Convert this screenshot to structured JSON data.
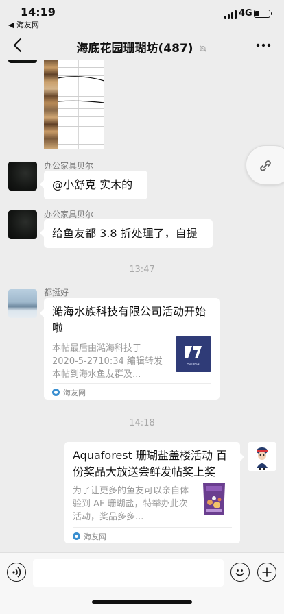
{
  "status": {
    "time": "14:19",
    "back_app": "◀ 海友网",
    "network": "4G",
    "battery_level": 0.3
  },
  "nav": {
    "title": "海底花园珊瑚坊(487)"
  },
  "messages": {
    "m1": {
      "nick": "办公家具贝尔",
      "text": "@小舒克 实木的"
    },
    "m2": {
      "nick": "办公家具贝尔",
      "text": "给鱼友都 3.8 折处理了，自提"
    },
    "t1": "13:47",
    "m3": {
      "nick": "都挺好",
      "card_title": "澔海水族科技有限公司活动开始啦",
      "card_desc": "本帖最后由澔海科技于 2020-5-2710:34 编辑转发本帖到海水鱼友群及...",
      "thumb_text": "HAOHAI",
      "source": "海友网"
    },
    "t2": "14:18",
    "m4": {
      "card_title": "Aquaforest 珊瑚盐盖楼活动 百份奖品大放送尝鲜发帖奖上奖",
      "card_desc": "为了让更多的鱼友可以亲自体验到 AF 珊瑚盐，特举办此次活动，奖品多多...",
      "source": "海友网"
    }
  },
  "colors": {
    "bg": "#ededed",
    "bubble": "#ffffff",
    "meta": "#a8a8a8",
    "source_icon": "#3a8fd0",
    "thumb_bg": "#2f3b77"
  },
  "icons": [
    "back-chevron-icon",
    "mute-bell-icon",
    "more-dots-icon",
    "link-icon",
    "voice-icon",
    "emoji-icon",
    "plus-icon"
  ]
}
